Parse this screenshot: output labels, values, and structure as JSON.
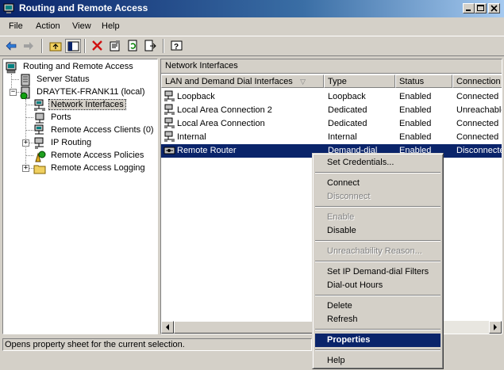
{
  "window": {
    "title": "Routing and Remote Access"
  },
  "menubar": {
    "items": [
      "File",
      "Action",
      "View",
      "Help"
    ]
  },
  "tree": {
    "root": "Routing and Remote Access",
    "server_status": "Server Status",
    "server": "DRAYTEK-FRANK11 (local)",
    "children": [
      "Network Interfaces",
      "Ports",
      "Remote Access Clients (0)",
      "IP Routing",
      "Remote Access Policies",
      "Remote Access Logging"
    ]
  },
  "right_pane": {
    "title": "Network Interfaces",
    "columns": [
      "LAN and Demand Dial Interfaces",
      "Type",
      "Status",
      "Connection"
    ],
    "rows": [
      {
        "name": "Loopback",
        "type": "Loopback",
        "status": "Enabled",
        "connection": "Connected"
      },
      {
        "name": "Local Area Connection 2",
        "type": "Dedicated",
        "status": "Enabled",
        "connection": "Unreachable"
      },
      {
        "name": "Local Area Connection",
        "type": "Dedicated",
        "status": "Enabled",
        "connection": "Connected"
      },
      {
        "name": "Internal",
        "type": "Internal",
        "status": "Enabled",
        "connection": "Connected"
      },
      {
        "name": "Remote Router",
        "type": "Demand-dial",
        "status": "Enabled",
        "connection": "Disconnected"
      }
    ]
  },
  "context_menu": {
    "items": {
      "set_credentials": "Set Credentials...",
      "connect": "Connect",
      "disconnect": "Disconnect",
      "enable": "Enable",
      "disable": "Disable",
      "unreachability": "Unreachability Reason...",
      "set_ip_filters": "Set IP Demand-dial Filters",
      "dialout_hours": "Dial-out Hours",
      "delete": "Delete",
      "refresh": "Refresh",
      "properties": "Properties",
      "help": "Help"
    }
  },
  "statusbar": {
    "text": "Opens property sheet for the current selection."
  }
}
